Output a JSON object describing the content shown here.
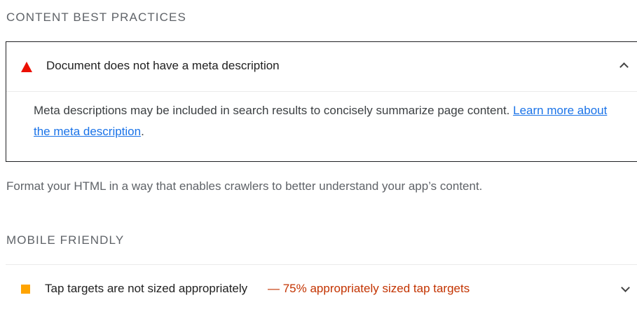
{
  "sections": {
    "content_best_practices": {
      "title": "CONTENT BEST PRACTICES",
      "audit": {
        "status": "fail",
        "title": "Document does not have a meta description",
        "description": "Meta descriptions may be included in search results to concisely summarize page content.",
        "link_text": "Learn more about the meta description",
        "trailing": "."
      },
      "group_description": "Format your HTML in a way that enables crawlers to better understand your app’s content."
    },
    "mobile_friendly": {
      "title": "MOBILE FRIENDLY",
      "audit": {
        "status": "average",
        "title": "Tap targets are not sized appropriately",
        "display_value": "— 75% appropriately sized tap targets"
      }
    }
  },
  "colors": {
    "fail": "#eb0f00",
    "average": "#ffa400",
    "display_value": "#c33300",
    "link": "#1a73e8"
  },
  "icons": [
    "fail-triangle-icon",
    "chevron-up-icon",
    "average-square-icon",
    "chevron-down-icon"
  ]
}
